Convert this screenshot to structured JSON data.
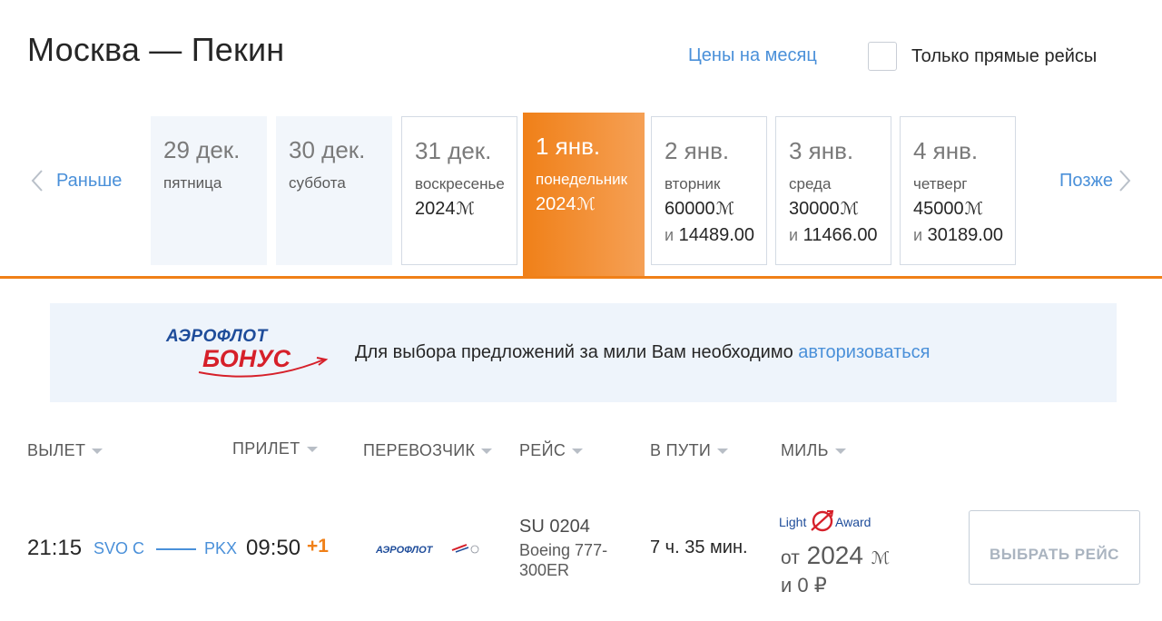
{
  "header": {
    "route_title": "Москва — Пекин",
    "month_link": "Цены на месяц",
    "direct_only_label": "Только прямые рейсы",
    "direct_only_checked": false
  },
  "date_nav": {
    "prev_label": "Раньше",
    "next_label": "Позже",
    "miles_symbol": "ℳ",
    "dates": [
      {
        "date": "29 дек.",
        "weekday": "пятница",
        "miles": "",
        "rub": "",
        "state": "disabled"
      },
      {
        "date": "30 дек.",
        "weekday": "суббота",
        "miles": "",
        "rub": "",
        "state": "disabled"
      },
      {
        "date": "31 дек.",
        "weekday": "воскресенье",
        "miles": "2024",
        "rub": "",
        "state": "normal"
      },
      {
        "date": "1 янв.",
        "weekday": "понедельник",
        "miles": "2024",
        "rub": "",
        "state": "selected"
      },
      {
        "date": "2 янв.",
        "weekday": "вторник",
        "miles": "60000",
        "rub": "14489.00",
        "state": "normal"
      },
      {
        "date": "3 янв.",
        "weekday": "среда",
        "miles": "30000",
        "rub": "11466.00",
        "state": "normal"
      },
      {
        "date": "4 янв.",
        "weekday": "четверг",
        "miles": "45000",
        "rub": "30189.00",
        "state": "normal"
      }
    ],
    "and_label": "и"
  },
  "bonus_banner": {
    "logo_line1": "АЭРОФЛОТ",
    "logo_line2": "БОНУС",
    "message": "Для выбора предложений за мили Вам необходимо ",
    "auth_link": "авторизоваться"
  },
  "table": {
    "columns": [
      "ВЫЛЕТ",
      "ПРИЛЕТ",
      "ПЕРЕВОЗЧИК",
      "РЕЙС",
      "В ПУТИ",
      "МИЛЬ"
    ]
  },
  "flight": {
    "dep_time": "21:15",
    "dep_airport": "SVO C",
    "arr_airport": "PKX",
    "arr_time": "09:50",
    "day_offset": "+1",
    "carrier": "АЭРОФЛОТ",
    "flight_no": "SU 0204",
    "aircraft": "Boeing 777-300ER",
    "duration": "7 ч. 35 мин.",
    "tariff_left": "Light",
    "tariff_right": "Award",
    "price_prefix": "от",
    "price_miles": "2024",
    "price_rub": "и 0 ₽",
    "select_label": "ВЫБРАТЬ РЕЙС"
  },
  "colors": {
    "accent": "#f08018",
    "link": "#4a90d9",
    "brand_blue": "#1e4c9a",
    "brand_red": "#d6202a"
  }
}
